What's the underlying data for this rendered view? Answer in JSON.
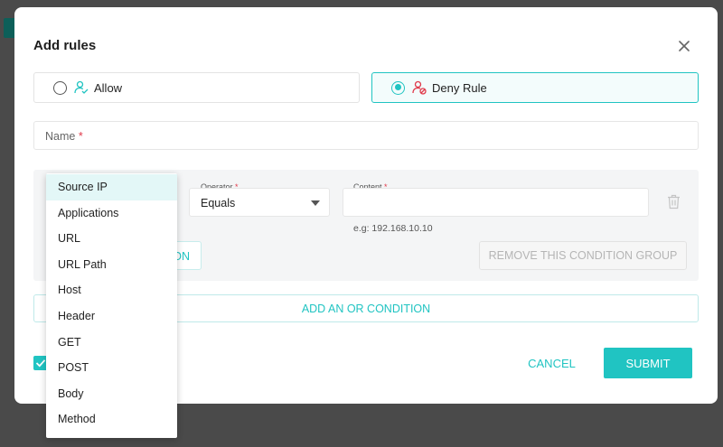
{
  "modal": {
    "title": "Add rules"
  },
  "rule_types": [
    {
      "label": "Allow",
      "selected": false
    },
    {
      "label": "Deny Rule",
      "selected": true
    }
  ],
  "name_field": {
    "label": "Name",
    "required_mark": "*"
  },
  "condition": {
    "operator": {
      "label": "Operator",
      "required_mark": "*",
      "value": "Equals"
    },
    "content": {
      "label": "Content",
      "required_mark": "*",
      "hint": "e.g: 192.168.10.10"
    },
    "add_and_button_fragment": "ON",
    "remove_group_label": "REMOVE THIS CONDITION GROUP"
  },
  "add_or_label": "ADD AN OR CONDITION",
  "footer": {
    "checkbox_checked": true,
    "cancel_label": "CANCEL",
    "submit_label": "SUBMIT"
  },
  "field_dropdown": {
    "highlighted": "Source IP",
    "options": [
      "Source IP",
      "Applications",
      "URL",
      "URL Path",
      "Host",
      "Header",
      "GET",
      "POST",
      "Body",
      "Method"
    ]
  },
  "colors": {
    "accent": "#20c4c2",
    "required": "#e0394a",
    "deny_icon": "#e0394a",
    "allow_icon": "#20c4c2"
  }
}
